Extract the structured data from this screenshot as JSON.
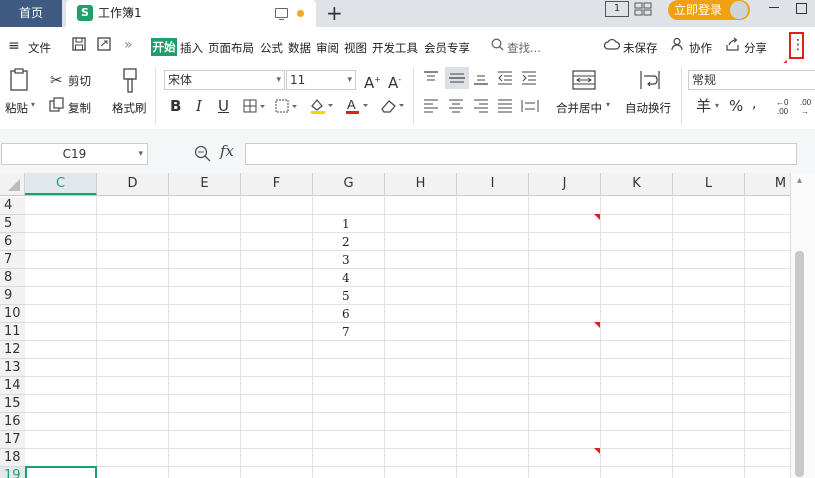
{
  "titlebar": {
    "home_tab": "首页",
    "doc_tab": {
      "icon_letter": "S",
      "title": "工作簿1"
    },
    "num_indicator": "1",
    "login_label": "立即登录"
  },
  "menubar": {
    "file_label": "文件",
    "more_chevron": "»",
    "tabs": [
      "开始",
      "插入",
      "页面布局",
      "公式",
      "数据",
      "审阅",
      "视图",
      "开发工具",
      "会员专享"
    ],
    "search_label": "查找...",
    "unsaved_label": "未保存",
    "collab_label": "协作",
    "share_label": "分享",
    "more_dots": "⋮"
  },
  "ribbon": {
    "paste_label": "粘贴",
    "cut_label": "剪切",
    "copy_label": "复制",
    "format_painter_label": "格式刷",
    "font_name": "宋体",
    "font_size": "11",
    "number_format": "常规",
    "merge_label": "合并居中",
    "wrap_label": "自动换行",
    "currency_symbol": "羊",
    "percent_symbol": "%"
  },
  "formula": {
    "cell_ref": "C19",
    "fx_label": "fx"
  },
  "sheet": {
    "columns": [
      "C",
      "D",
      "E",
      "F",
      "G",
      "H",
      "I",
      "J",
      "K",
      "L",
      "M"
    ],
    "active_column": "C",
    "rows": [
      "4",
      "5",
      "6",
      "7",
      "8",
      "9",
      "10",
      "11",
      "12",
      "13",
      "14",
      "15",
      "16",
      "17",
      "18",
      "19"
    ],
    "active_row": "19",
    "active_cell": "C19",
    "g_values": [
      {
        "row": "5",
        "value": "1"
      },
      {
        "row": "6",
        "value": "2"
      },
      {
        "row": "7",
        "value": "3"
      },
      {
        "row": "8",
        "value": "4"
      },
      {
        "row": "9",
        "value": "5"
      },
      {
        "row": "10",
        "value": "6"
      },
      {
        "row": "11",
        "value": "7"
      }
    ],
    "comment_marker_rows": [
      "5",
      "11",
      "18"
    ]
  },
  "colors": {
    "accent_green": "#1f9f6a",
    "home_tab_bg": "#3f5a80",
    "login_orange": "#f0a010",
    "highlight_red": "#e0201a"
  }
}
